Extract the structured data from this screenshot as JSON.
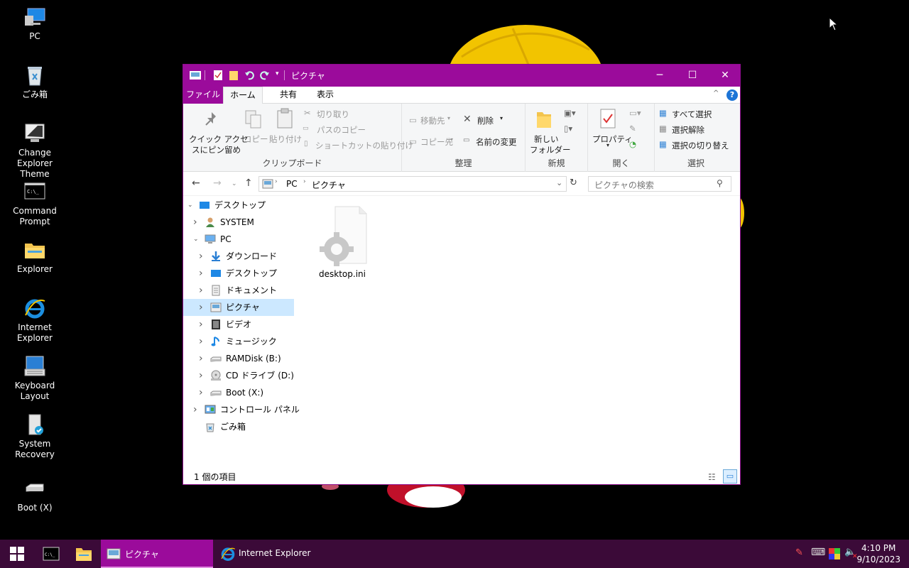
{
  "desktop": {
    "icons": [
      {
        "label": "PC",
        "icon": "pc-icon"
      },
      {
        "label": "ごみ箱",
        "icon": "recycle-bin-icon"
      },
      {
        "label": "Change Explorer Theme",
        "icon": "theme-icon"
      },
      {
        "label": "Command Prompt",
        "icon": "cmd-icon"
      },
      {
        "label": "Explorer",
        "icon": "folder-icon"
      },
      {
        "label": "Internet Explorer",
        "icon": "ie-icon"
      },
      {
        "label": "Keyboard Layout",
        "icon": "keyboard-icon"
      },
      {
        "label": "System Recovery",
        "icon": "recovery-icon"
      },
      {
        "label": "Boot (X)",
        "icon": "drive-icon"
      }
    ]
  },
  "window": {
    "title": "ピクチャ",
    "accent": "#9b0b9b",
    "tabs": {
      "file": "ファイル",
      "home": "ホーム",
      "share": "共有",
      "view": "表示"
    },
    "ribbon": {
      "clipboard": {
        "label": "クリップボード",
        "pin_line1": "クイック アクセ",
        "pin_line2": "スにピン留め",
        "copy": "コピー",
        "paste": "貼り付け",
        "cut": "切り取り",
        "copy_path": "パスのコピー",
        "paste_shortcut": "ショートカットの貼り付け"
      },
      "organize": {
        "label": "整理",
        "move_to": "移動先",
        "copy_to": "コピー先",
        "delete": "削除",
        "rename": "名前の変更"
      },
      "new": {
        "label": "新規",
        "new_folder_line1": "新しい",
        "new_folder_line2": "フォルダー"
      },
      "open": {
        "label": "開く",
        "properties": "プロパティ"
      },
      "select": {
        "label": "選択",
        "select_all": "すべて選択",
        "select_none": "選択解除",
        "invert": "選択の切り替え"
      }
    },
    "address": {
      "segments": [
        "PC",
        "ピクチャ"
      ]
    },
    "search": {
      "placeholder": "ピクチャの検索"
    },
    "tree": [
      {
        "label": "デスクトップ",
        "expanded": true
      },
      {
        "label": "SYSTEM"
      },
      {
        "label": "PC",
        "expanded": true
      },
      {
        "label": "ダウンロード"
      },
      {
        "label": "デスクトップ"
      },
      {
        "label": "ドキュメント"
      },
      {
        "label": "ピクチャ",
        "selected": true
      },
      {
        "label": "ビデオ"
      },
      {
        "label": "ミュージック"
      },
      {
        "label": "RAMDisk (B:)"
      },
      {
        "label": "CD ドライブ (D:)"
      },
      {
        "label": "Boot (X:)"
      },
      {
        "label": "コントロール パネル"
      },
      {
        "label": "ごみ箱"
      }
    ],
    "files": [
      {
        "name": "desktop.ini",
        "icon": "settings-file-icon"
      }
    ],
    "status": "1 個の項目"
  },
  "taskbar": {
    "color": "#3b0a38",
    "active_window": "ピクチャ",
    "ie_window": "Internet Explorer",
    "time": "4:10 PM",
    "date": "9/10/2023"
  }
}
